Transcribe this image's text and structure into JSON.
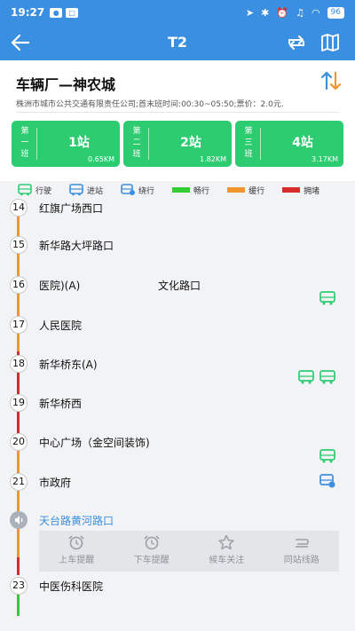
{
  "status_bar": {
    "time": "19:27",
    "battery": "96"
  },
  "app_bar": {
    "title": "T2"
  },
  "route": {
    "name": "车辆厂—神农城",
    "info": "株洲市城市公共交通有限责任公司;首末班时间:00:30~05:50;票价：2.0元."
  },
  "shifts": [
    {
      "label": "第一班",
      "stop": "1站",
      "distance": "0.65KM"
    },
    {
      "label": "第二班",
      "stop": "2站",
      "distance": "1.82KM"
    },
    {
      "label": "第三班",
      "stop": "4站",
      "distance": "3.17KM"
    }
  ],
  "legend": {
    "moving": "行驶",
    "arriving": "进站",
    "detour": "绕行",
    "smooth": "畅行",
    "slow": "缓行",
    "congested": "拥堵"
  },
  "colors": {
    "accent": "#3b8fe0",
    "smooth": "#33cc33",
    "slow": "#f0962a",
    "congested": "#d62b2b",
    "bus": "#2ecc71"
  },
  "stops": [
    {
      "num": "14",
      "name": "红旗广场西口"
    },
    {
      "num": "15",
      "name": "新华路大坪路口"
    },
    {
      "num": "16",
      "name": "医院)(A)",
      "extra": "文化路口"
    },
    {
      "num": "17",
      "name": "人民医院"
    },
    {
      "num": "18",
      "name": "新华桥东(A)"
    },
    {
      "num": "19",
      "name": "新华桥西"
    },
    {
      "num": "20",
      "name": "中心广场（金空间装饰)"
    },
    {
      "num": "21",
      "name": "市政府"
    },
    {
      "num": "",
      "name": "天台路黄河路口"
    },
    {
      "num": "23",
      "name": "中医伤科医院"
    }
  ],
  "actions": {
    "board_alert": "上车提醒",
    "alight_alert": "下车提醒",
    "follow": "候车关注",
    "transfer": "同站线路"
  }
}
